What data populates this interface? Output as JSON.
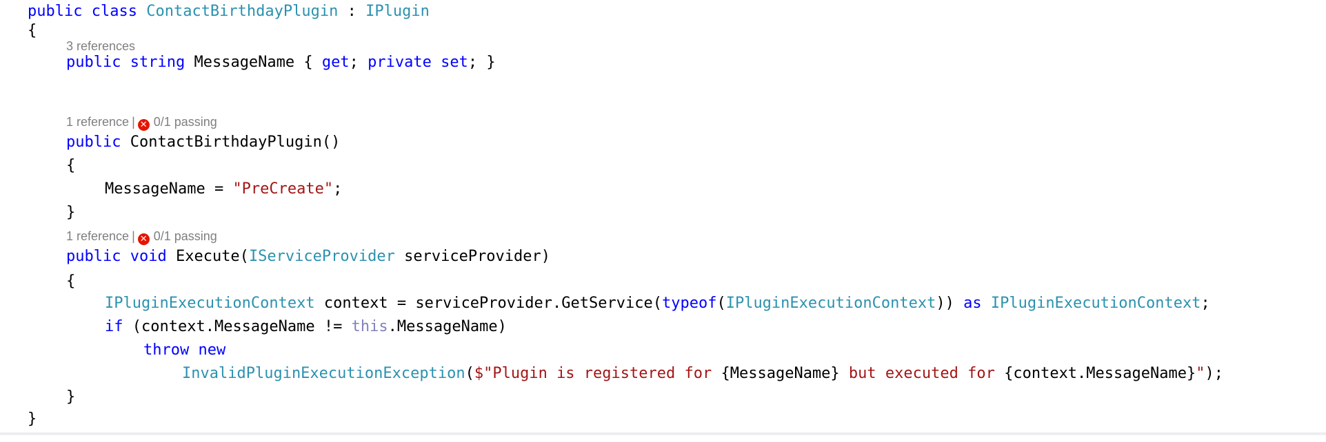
{
  "code": {
    "class_decl": {
      "kw1": "public",
      "kw2": "class",
      "name": "ContactBirthdayPlugin",
      "colon": " : ",
      "iface": "IPlugin"
    },
    "brace_open": "{",
    "brace_close": "}",
    "lens_prop": {
      "refs": "3 references"
    },
    "prop_decl": {
      "kw1": "public",
      "kw2": "string",
      "name": " MessageName { ",
      "kw_get": "get",
      "semi1": "; ",
      "kw_private": "private",
      "kw_set": "set",
      "end": "; }"
    },
    "lens_ctor": {
      "refs": "1 reference",
      "sep": "|",
      "tests": "0/1 passing"
    },
    "ctor_decl": {
      "kw": "public",
      "name": " ContactBirthdayPlugin()"
    },
    "ctor_body": {
      "lhs": "MessageName = ",
      "str": "\"PreCreate\"",
      "end": ";"
    },
    "lens_exec": {
      "refs": "1 reference",
      "sep": "|",
      "tests": "0/1 passing"
    },
    "exec_decl": {
      "kw1": "public",
      "kw2": "void",
      "name": " Execute(",
      "type": "IServiceProvider",
      "end": " serviceProvider)"
    },
    "ctx_line": {
      "type1": "IPluginExecutionContext",
      "mid1": " context = serviceProvider.GetService(",
      "kw_typeof": "typeof",
      "paren": "(",
      "type2": "IPluginExecutionContext",
      "mid2": ")) ",
      "kw_as": "as",
      "sp": " ",
      "type3": "IPluginExecutionContext",
      "end": ";"
    },
    "if_line": {
      "kw_if": "if",
      "mid": " (context.MessageName != ",
      "kw_this": "this",
      "end": ".MessageName)"
    },
    "throw_line": {
      "kw_throw": "throw",
      "sp": " ",
      "kw_new": "new"
    },
    "exc_line": {
      "type": "InvalidPluginExecutionException",
      "open": "(",
      "str1": "$\"Plugin is registered for ",
      "interp1": "{MessageName}",
      "str2": " but executed for ",
      "interp2": "{context.MessageName}",
      "str3": "\"",
      "end": ");"
    }
  },
  "colors": {
    "keyword": "#0000ff",
    "type": "#2b91af",
    "string": "#a31515",
    "codelens": "#7f7f7f",
    "fail": "#e51400"
  },
  "icons": {
    "test_fail": "x-circle-icon"
  }
}
